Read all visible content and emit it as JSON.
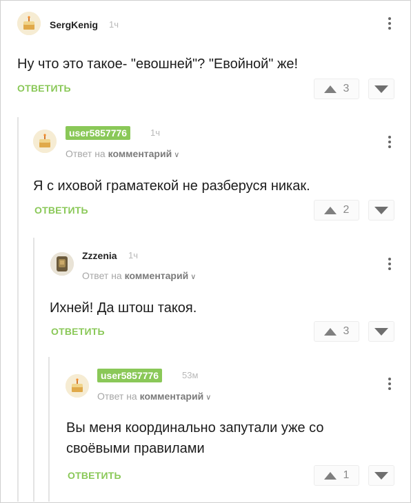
{
  "comments": [
    {
      "username": "SergKenig",
      "time": "1ч",
      "text": "Ну что это такое- \"евошней\"? \"Евойной\" же!",
      "reply_label": "ОТВЕТИТЬ",
      "votes": "3",
      "avatar": "cake-icon"
    },
    {
      "username": "user5857776",
      "time": "1ч",
      "reply_prefix": "Ответ на",
      "reply_target": "комментарий",
      "text": "Я с иховой граматекой не разберуся никак.",
      "reply_label": "ОТВЕТИТЬ",
      "votes": "2",
      "avatar": "cake-icon"
    },
    {
      "username": "Zzzenia",
      "time": "1ч",
      "reply_prefix": "Ответ на",
      "reply_target": "комментарий",
      "text": "Ихней! Да штош такоя.",
      "reply_label": "ОТВЕТИТЬ",
      "votes": "3",
      "avatar": "photo-avatar"
    },
    {
      "username": "user5857776",
      "time": "53м",
      "reply_prefix": "Ответ на",
      "reply_target": "комментарий",
      "text_line1": "Вы меня координально запутали уже со",
      "text_line2": "своёвыми правилами",
      "reply_label": "ОТВЕТИТЬ",
      "votes": "1",
      "avatar": "cake-icon"
    }
  ],
  "colors": {
    "accent_green": "#8ac858",
    "thread_line": "#e3e3e3"
  }
}
